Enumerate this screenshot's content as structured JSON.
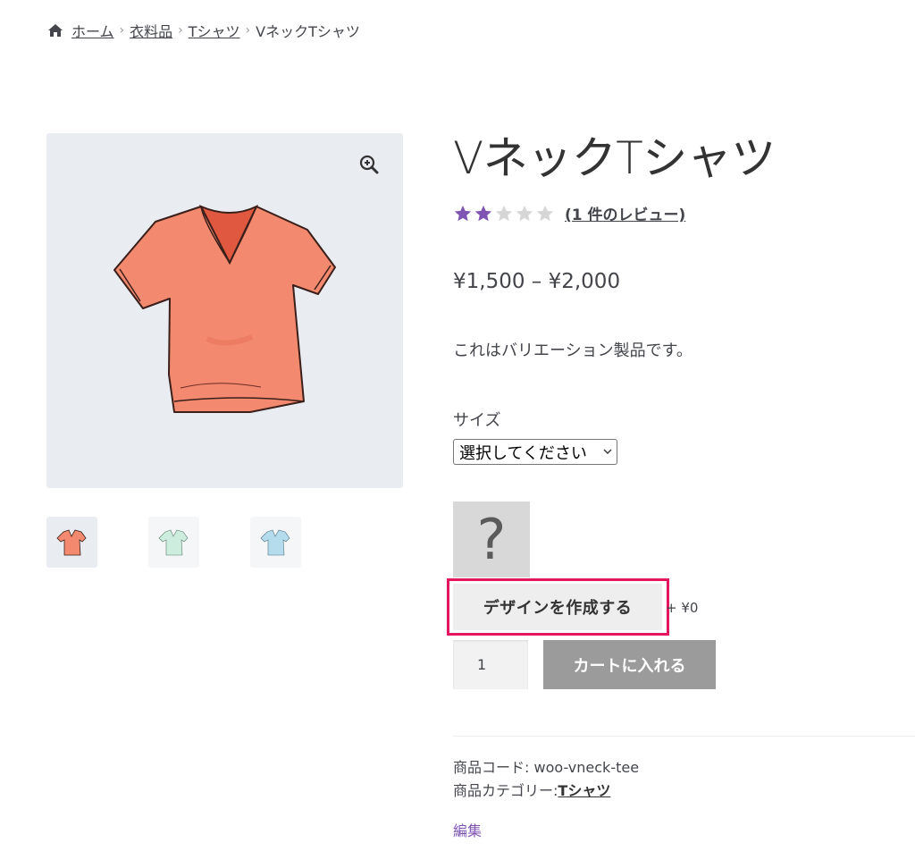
{
  "breadcrumb": {
    "icon": "home-icon",
    "items": [
      "ホーム",
      "衣料品",
      "Tシャツ"
    ],
    "current": "VネックTシャツ"
  },
  "gallery": {
    "zoom_icon": "zoom-in-icon",
    "main_image": "coral-vneck-tshirt",
    "thumbnails": [
      "coral-vneck-tshirt",
      "mint-vneck-tshirt",
      "blue-vneck-tshirt"
    ]
  },
  "product": {
    "title": "VネックTシャツ",
    "rating": 2,
    "rating_max": 5,
    "review_link": "(1 件のレビュー)",
    "price": "¥1,500 – ¥2,000",
    "description": "これはバリエーション製品です。",
    "size_label": "サイズ",
    "size_select": "選択してください",
    "placeholder_glyph": "?",
    "design_button": "デザインを作成する",
    "addon_price": "+ ¥0",
    "quantity": "1",
    "add_to_cart": "カートに入れる",
    "sku_label": "商品コード:",
    "sku": "woo-vneck-tee",
    "category_label": "商品カテゴリー:",
    "category": "Tシャツ",
    "edit_link": "編集"
  },
  "colors": {
    "accent": "#7f54b3",
    "highlight": "#e5165d",
    "cart_button": "#9b9b9b",
    "star_filled": "#7f54b3",
    "star_empty": "#d6d6d6"
  }
}
